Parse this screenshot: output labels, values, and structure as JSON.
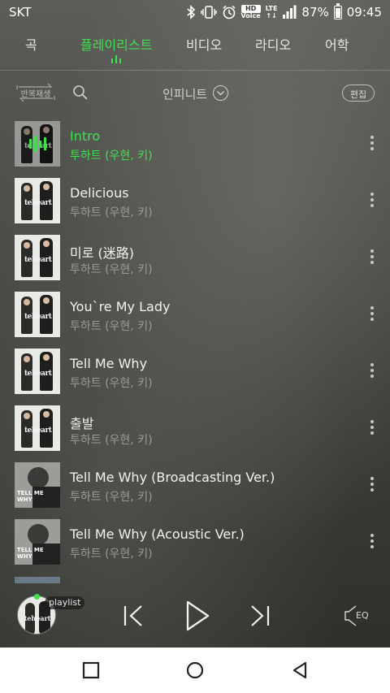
{
  "status_bar": {
    "carrier": "SKT",
    "hd_label": "HD",
    "voice_label": "Voice",
    "lte_label": "LTE",
    "lte_arrows": "↑↓",
    "battery": "87%",
    "time": "09:45"
  },
  "tabs": [
    {
      "label": "곡",
      "active": false
    },
    {
      "label": "플레이리스트",
      "active": true
    },
    {
      "label": "비디오",
      "active": false
    },
    {
      "label": "라디오",
      "active": false
    },
    {
      "label": "어학",
      "active": false
    }
  ],
  "toolbar": {
    "repeat_label": "반복재생",
    "sort_label": "인피니트",
    "edit_label": "편집"
  },
  "album_logo": "teheart",
  "alt_cover_text": "TELL ME WHY",
  "tracks": [
    {
      "title": "Intro",
      "artist": "투하트 (우현, 키)",
      "playing": true,
      "cover": "teheart"
    },
    {
      "title": "Delicious",
      "artist": "투하트 (우현, 키)",
      "playing": false,
      "cover": "teheart"
    },
    {
      "title": "미로 (迷路)",
      "artist": "투하트 (우현, 키)",
      "playing": false,
      "cover": "teheart"
    },
    {
      "title": "You`re My Lady",
      "artist": "투하트 (우현, 키)",
      "playing": false,
      "cover": "teheart"
    },
    {
      "title": "Tell Me Why",
      "artist": "투하트 (우현, 키)",
      "playing": false,
      "cover": "teheart"
    },
    {
      "title": "출발",
      "artist": "투하트 (우현, 키)",
      "playing": false,
      "cover": "teheart"
    },
    {
      "title": "Tell Me Why (Broadcasting Ver.)",
      "artist": "투하트 (우현, 키)",
      "playing": false,
      "cover": "tellmewhy"
    },
    {
      "title": "Tell Me Why (Acoustic Ver.)",
      "artist": "투하트 (우현, 키)",
      "playing": false,
      "cover": "tellmewhy"
    }
  ],
  "player": {
    "playlist_tag": "playlist",
    "eq_label": "EQ",
    "state": "paused"
  },
  "colors": {
    "accent": "#3fe04f",
    "text": "#f2f2f2",
    "subtext": "#9a9a98",
    "nav_bg": "#ffffff"
  },
  "icons": {
    "status": [
      "bluetooth-icon",
      "vibrate-icon",
      "alarm-icon",
      "hd-voice-icon",
      "lte-icon",
      "signal-icon",
      "battery-icon"
    ],
    "toolbar": [
      "repeat-icon",
      "search-icon",
      "chevron-down-icon"
    ],
    "row": [
      "more-vertical-icon"
    ],
    "player": [
      "previous-icon",
      "play-icon",
      "next-icon",
      "equalizer-icon"
    ],
    "nav": [
      "recent-apps-icon",
      "home-icon",
      "back-icon"
    ]
  }
}
